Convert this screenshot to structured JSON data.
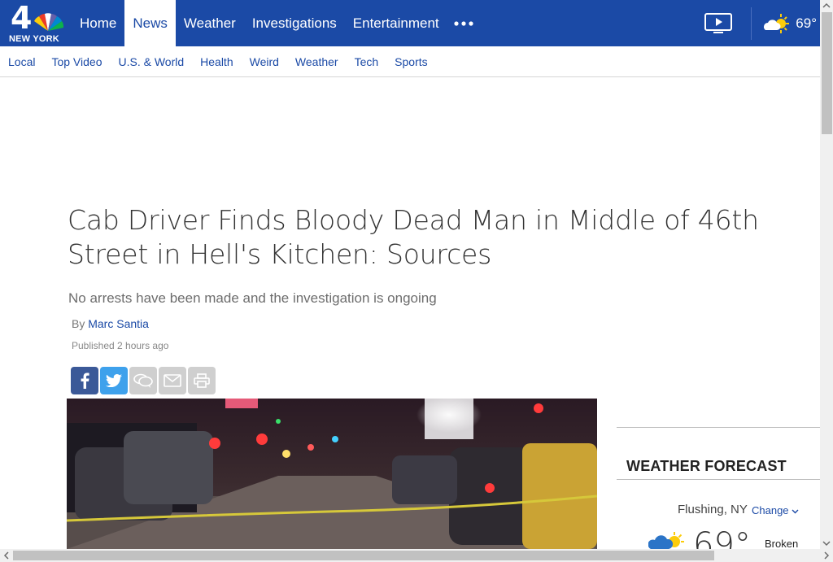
{
  "brand": {
    "logo_text": "4",
    "logo_subtext": "NEW YORK"
  },
  "topnav": {
    "items": [
      "Home",
      "News",
      "Weather",
      "Investigations",
      "Entertainment"
    ],
    "active": "News",
    "temperature": "69°"
  },
  "subnav": {
    "items": [
      "Local",
      "Top Video",
      "U.S. & World",
      "Health",
      "Weird",
      "Weather",
      "Tech",
      "Sports"
    ]
  },
  "article": {
    "headline": "Cab Driver Finds Bloody Dead Man in Middle of 46th Street in Hell's Kitchen: Sources",
    "subhead": "No arrests have been made and the investigation is ongoing",
    "byline_prefix": "By",
    "author": "Marc Santia",
    "published": "Published 2 hours ago"
  },
  "share_icons": [
    "facebook-icon",
    "twitter-icon",
    "comment-icon",
    "email-icon",
    "print-icon"
  ],
  "weather_forecast": {
    "title": "WEATHER FORECAST",
    "location": "Flushing, NY",
    "change_label": "Change",
    "temperature": "69°",
    "condition": "Broken"
  },
  "colors": {
    "brand_blue": "#1b4aa6",
    "facebook": "#3b5998",
    "twitter": "#3ea1ec"
  }
}
